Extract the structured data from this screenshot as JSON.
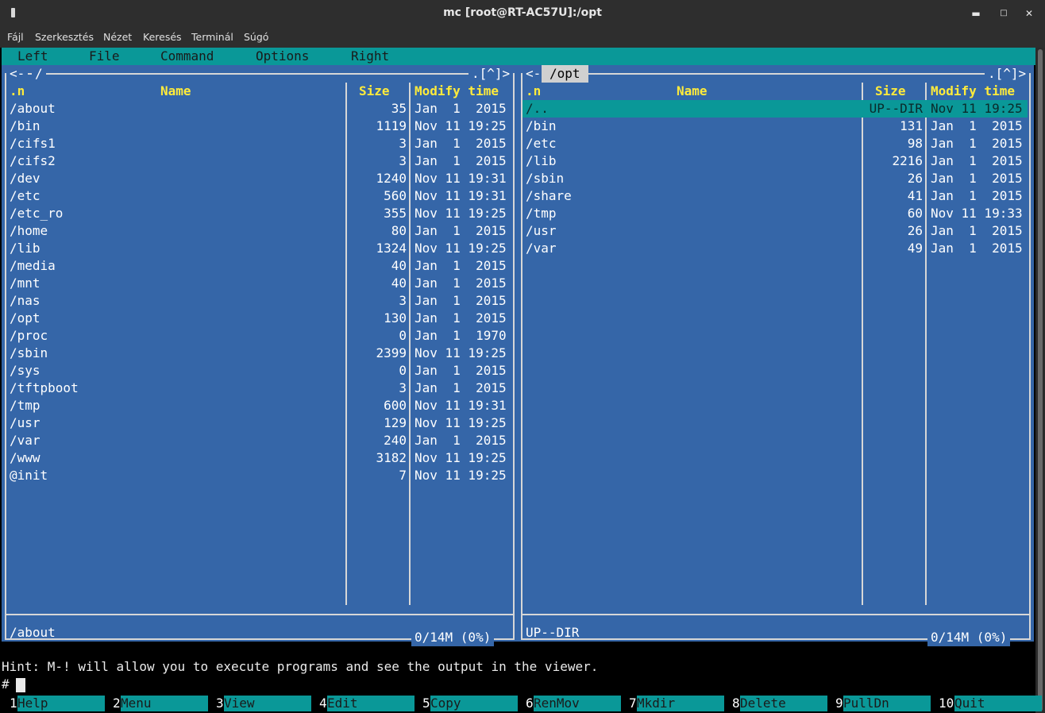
{
  "window": {
    "title": "mc [root@RT-AC57U]:/opt"
  },
  "menubar": [
    "Fájl",
    "Szerkesztés",
    "Nézet",
    "Keresés",
    "Terminál",
    "Súgó"
  ],
  "mc_menu": [
    "Left",
    "File",
    "Command",
    "Options",
    "Right"
  ],
  "left_panel": {
    "path": "/",
    "nav_left": "<-",
    "nav_right": ".[^]>",
    "headers": {
      "sort": ".n",
      "name": "Name",
      "size": "Size",
      "mtime": "Modify time"
    },
    "rows": [
      {
        "name": "/about",
        "size": "35",
        "mtime": "Jan  1  2015"
      },
      {
        "name": "/bin",
        "size": "1119",
        "mtime": "Nov 11 19:25"
      },
      {
        "name": "/cifs1",
        "size": "3",
        "mtime": "Jan  1  2015"
      },
      {
        "name": "/cifs2",
        "size": "3",
        "mtime": "Jan  1  2015"
      },
      {
        "name": "/dev",
        "size": "1240",
        "mtime": "Nov 11 19:31"
      },
      {
        "name": "/etc",
        "size": "560",
        "mtime": "Nov 11 19:31"
      },
      {
        "name": "/etc_ro",
        "size": "355",
        "mtime": "Nov 11 19:25"
      },
      {
        "name": "/home",
        "size": "80",
        "mtime": "Jan  1  2015"
      },
      {
        "name": "/lib",
        "size": "1324",
        "mtime": "Nov 11 19:25"
      },
      {
        "name": "/media",
        "size": "40",
        "mtime": "Jan  1  2015"
      },
      {
        "name": "/mnt",
        "size": "40",
        "mtime": "Jan  1  2015"
      },
      {
        "name": "/nas",
        "size": "3",
        "mtime": "Jan  1  2015"
      },
      {
        "name": "/opt",
        "size": "130",
        "mtime": "Jan  1  2015"
      },
      {
        "name": "/proc",
        "size": "0",
        "mtime": "Jan  1  1970"
      },
      {
        "name": "/sbin",
        "size": "2399",
        "mtime": "Nov 11 19:25"
      },
      {
        "name": "/sys",
        "size": "0",
        "mtime": "Jan  1  2015"
      },
      {
        "name": "/tftpboot",
        "size": "3",
        "mtime": "Jan  1  2015"
      },
      {
        "name": "/tmp",
        "size": "600",
        "mtime": "Nov 11 19:31"
      },
      {
        "name": "/usr",
        "size": "129",
        "mtime": "Nov 11 19:25"
      },
      {
        "name": "/var",
        "size": "240",
        "mtime": "Jan  1  2015"
      },
      {
        "name": "/www",
        "size": "3182",
        "mtime": "Nov 11 19:25"
      },
      {
        "name": "@init",
        "size": "7",
        "mtime": "Nov 11 19:25"
      }
    ],
    "mini_status": "/about",
    "free_space": "0/14M (0%)"
  },
  "right_panel": {
    "path": "/opt",
    "nav_left": "<-",
    "nav_right": ".[^]>",
    "headers": {
      "sort": ".n",
      "name": "Name",
      "size": "Size",
      "mtime": "Modify time"
    },
    "rows": [
      {
        "name": "/..",
        "size": "UP--DIR",
        "mtime": "Nov 11 19:25"
      },
      {
        "name": "/bin",
        "size": "131",
        "mtime": "Jan  1  2015"
      },
      {
        "name": "/etc",
        "size": "98",
        "mtime": "Jan  1  2015"
      },
      {
        "name": "/lib",
        "size": "2216",
        "mtime": "Jan  1  2015"
      },
      {
        "name": "/sbin",
        "size": "26",
        "mtime": "Jan  1  2015"
      },
      {
        "name": "/share",
        "size": "41",
        "mtime": "Jan  1  2015"
      },
      {
        "name": "/tmp",
        "size": "60",
        "mtime": "Nov 11 19:33"
      },
      {
        "name": "/usr",
        "size": "26",
        "mtime": "Jan  1  2015"
      },
      {
        "name": "/var",
        "size": "49",
        "mtime": "Jan  1  2015"
      }
    ],
    "mini_status": "UP--DIR",
    "free_space": "0/14M (0%)"
  },
  "hint": "Hint: M-! will allow you to execute programs and see the output in the viewer.",
  "prompt": "#",
  "fkeys": [
    {
      "num": "1",
      "label": "Help"
    },
    {
      "num": "2",
      "label": "Menu"
    },
    {
      "num": "3",
      "label": "View"
    },
    {
      "num": "4",
      "label": "Edit"
    },
    {
      "num": "5",
      "label": "Copy"
    },
    {
      "num": "6",
      "label": "RenMov"
    },
    {
      "num": "7",
      "label": "Mkdir"
    },
    {
      "num": "8",
      "label": "Delete"
    },
    {
      "num": "9",
      "label": "PullDn"
    },
    {
      "num": "10",
      "label": "Quit"
    }
  ]
}
